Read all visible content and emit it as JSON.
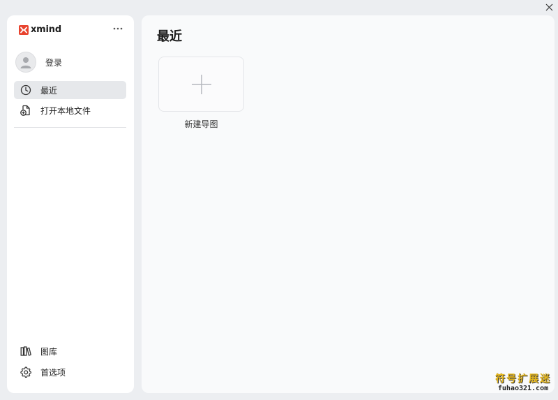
{
  "window": {
    "close_icon": "close-icon"
  },
  "sidebar": {
    "logo_text": "xmind",
    "more_icon": "more-horizontal-icon",
    "login_label": "登录",
    "nav": [
      {
        "label": "最近",
        "icon": "clock-icon",
        "active": true
      },
      {
        "label": "打开本地文件",
        "icon": "open-file-icon",
        "active": false
      }
    ],
    "bottom": [
      {
        "label": "图库",
        "icon": "library-icon"
      },
      {
        "label": "首选项",
        "icon": "gear-icon"
      }
    ]
  },
  "main": {
    "title": "最近",
    "new_card_label": "新建导图"
  },
  "watermark": {
    "cn": "符号扩展迷",
    "en": "fuhao321.com"
  },
  "colors": {
    "brand": "#e8432e",
    "active_bg": "#e6e8eb",
    "watermark": "#e7b81e"
  }
}
